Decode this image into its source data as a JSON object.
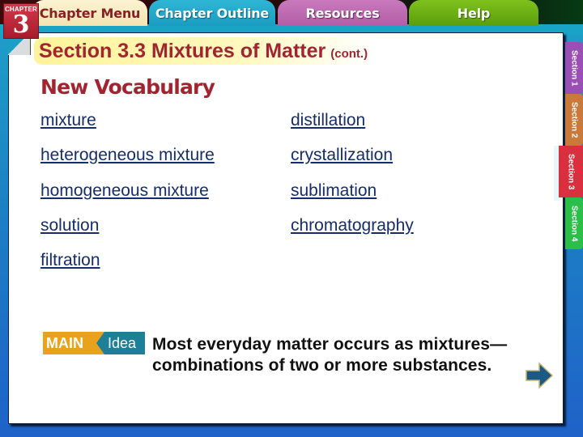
{
  "nav": {
    "chapter_label": "CHAPTER",
    "chapter_number": "3",
    "tabs": [
      {
        "label": "Chapter Menu"
      },
      {
        "label": "Chapter Outline"
      },
      {
        "label": "Resources"
      },
      {
        "label": "Help"
      }
    ],
    "section_tabs": [
      {
        "label": "Section 1"
      },
      {
        "label": "Section 2"
      },
      {
        "label": "Section 3",
        "active": true
      },
      {
        "label": "Section 4"
      }
    ]
  },
  "slide": {
    "title": "Section 3.3  Mixtures of Matter",
    "title_suffix": "(cont.)",
    "heading": "New Vocabulary",
    "vocabulary_left": [
      "mixture",
      "heterogeneous mixture",
      "homogeneous mixture",
      "solution",
      "filtration"
    ],
    "vocabulary_right": [
      "distillation",
      "crystallization",
      "sublimation",
      "chromatography"
    ],
    "main_idea": {
      "badge_main": "MAIN",
      "badge_idea": "Idea",
      "text": "Most everyday matter occurs as mixtures—combinations of two or more substances."
    }
  },
  "icons": {
    "next": "right-arrow-icon"
  },
  "colors": {
    "title": "#a32431",
    "link": "#152d6b",
    "main_badge_orange": "#e8a21c",
    "main_badge_teal": "#1d7f98"
  }
}
